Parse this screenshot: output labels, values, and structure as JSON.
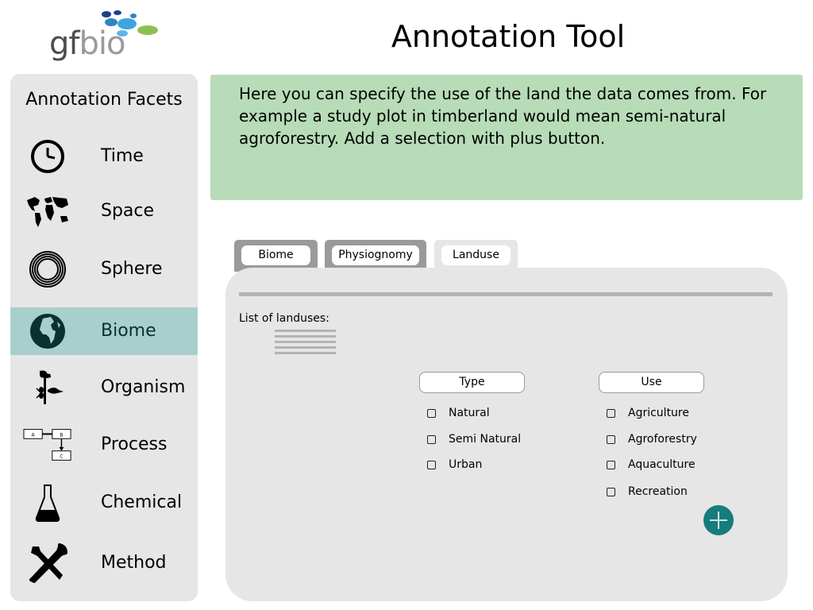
{
  "header": {
    "logo_text_1": "gf",
    "logo_text_2": "bio",
    "app_title": "Annotation Tool"
  },
  "sidebar": {
    "title": "Annotation Facets",
    "items": [
      {
        "label": "Time",
        "icon": "clock-icon"
      },
      {
        "label": "Space",
        "icon": "world-map-icon"
      },
      {
        "label": "Sphere",
        "icon": "concentric-circles-icon"
      },
      {
        "label": "Biome",
        "icon": "globe-icon",
        "active": true
      },
      {
        "label": "Organism",
        "icon": "organism-icon"
      },
      {
        "label": "Process",
        "icon": "flowchart-icon"
      },
      {
        "label": "Chemical",
        "icon": "flask-icon"
      },
      {
        "label": "Method",
        "icon": "tools-icon"
      }
    ]
  },
  "info": {
    "text": "Here you can specify the use of the land the data comes from. For example a study plot in timberland would mean semi-natural agroforestry. Add a selection with plus button."
  },
  "tabs": [
    {
      "label": "Biome",
      "active": false
    },
    {
      "label": "Physiognomy",
      "active": false
    },
    {
      "label": "Landuse",
      "active": true
    }
  ],
  "panel": {
    "list_title": "List of landuses:",
    "type_header": "Type",
    "use_header": "Use",
    "type_options": [
      "Natural",
      "Semi Natural",
      "Urban"
    ],
    "use_options": [
      "Agriculture",
      "Agroforestry",
      "Aquaculture",
      "Recreation"
    ],
    "add_icon": "plus-icon"
  },
  "colors": {
    "sidebar_bg": "#e6e6e6",
    "active_facet": "#a8cfcd",
    "info_bg": "#b7dcb7",
    "add_button": "#167c7c",
    "tab_inactive": "#9a9a9a"
  }
}
